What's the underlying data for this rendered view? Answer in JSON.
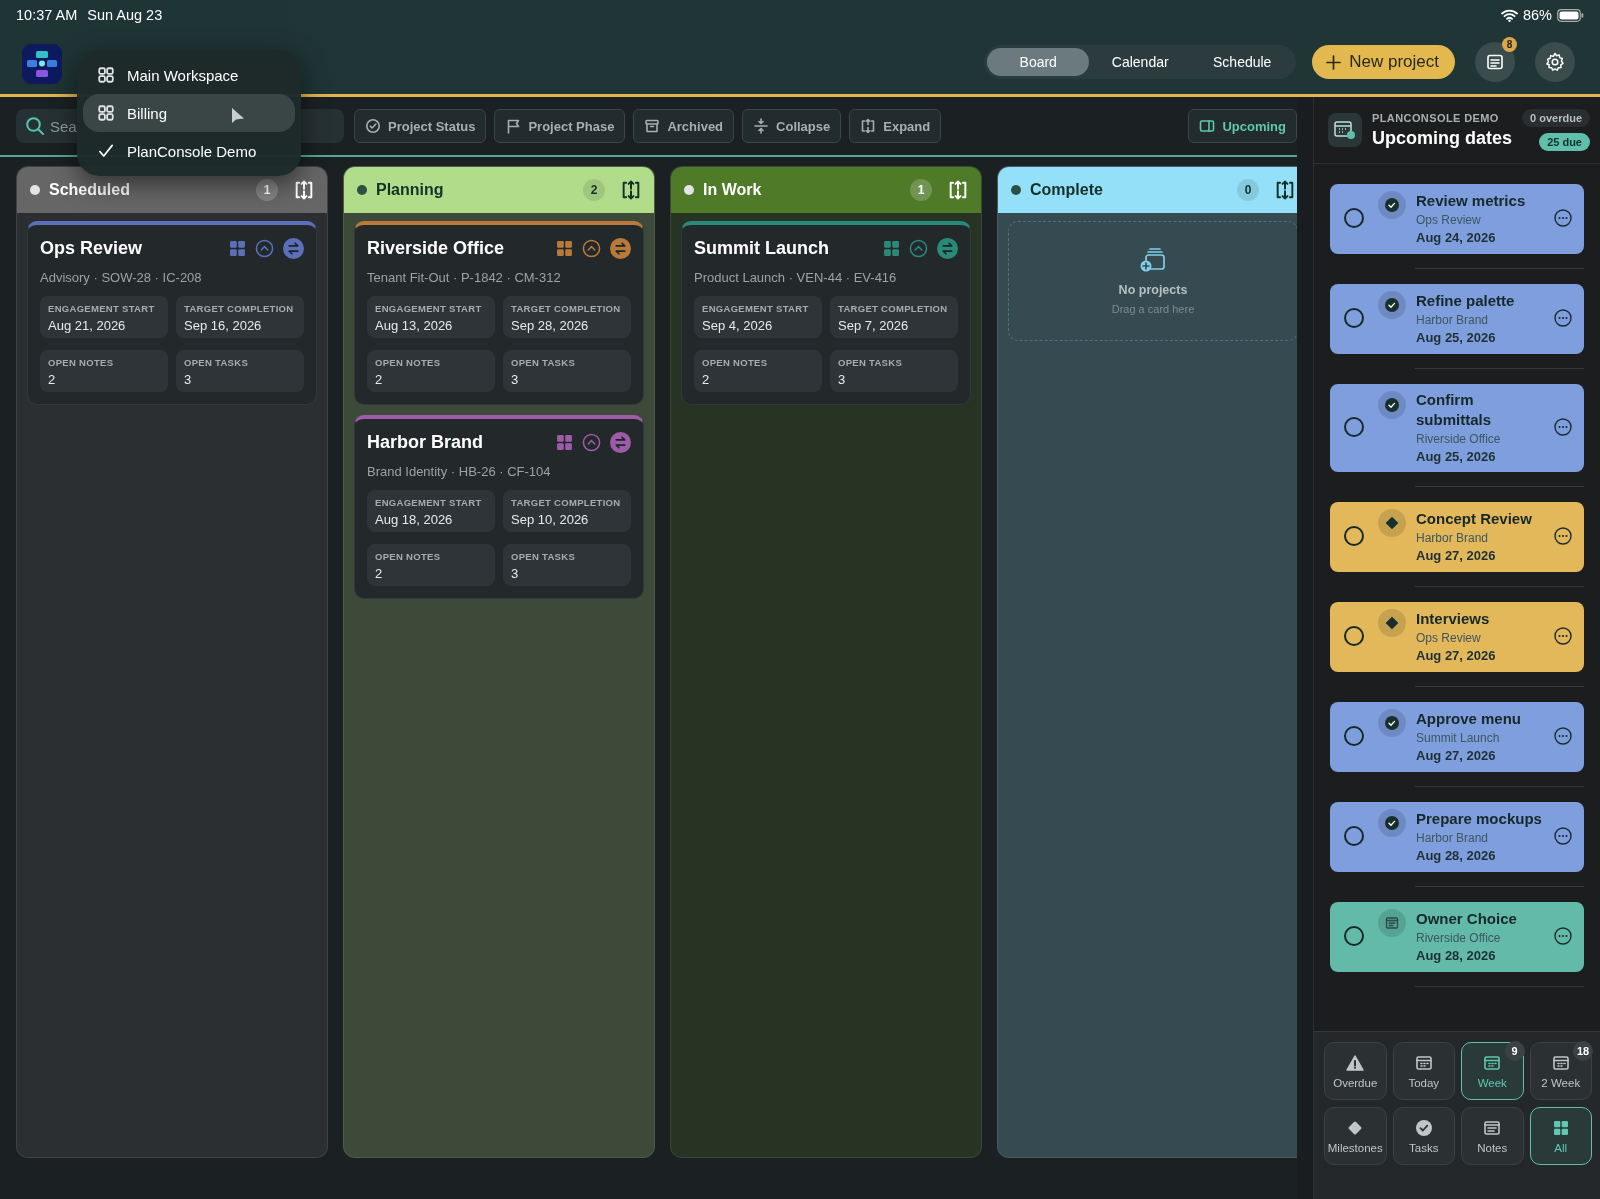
{
  "status_bar": {
    "time": "10:37 AM",
    "date": "Sun Aug 23",
    "battery": "86%"
  },
  "header": {
    "views": [
      {
        "label": "Board",
        "selected": true
      },
      {
        "label": "Calendar",
        "selected": false
      },
      {
        "label": "Schedule",
        "selected": false
      }
    ],
    "new_button": "New project",
    "notifications_badge": "8"
  },
  "workspace_menu": {
    "items": [
      {
        "label": "Main Workspace",
        "checked": false,
        "hovered": false
      },
      {
        "label": "Billing",
        "checked": false,
        "hovered": true
      },
      {
        "label": "PlanConsole Demo",
        "checked": true,
        "hovered": false
      }
    ]
  },
  "toolbar": {
    "search": {
      "placeholder": "Sea"
    },
    "filters": [
      {
        "label": "Project Status",
        "kind": "status"
      },
      {
        "label": "Project Phase",
        "kind": "phase"
      },
      {
        "label": "Archived",
        "kind": "archived"
      },
      {
        "label": "Collapse",
        "kind": "collapse"
      },
      {
        "label": "Expand",
        "kind": "expand"
      }
    ],
    "upcoming": {
      "label": "Upcoming",
      "selected": true
    }
  },
  "columns": [
    {
      "title": "Scheduled",
      "count": "1",
      "color": "#666666",
      "cards": [
        {
          "title": "Ops Review",
          "subtitle": "Advisory · SOW-28 · IC-208",
          "color": "#5b70b8",
          "stats": [
            {
              "label": "ENGAGEMENT START",
              "value": "Aug 21, 2026"
            },
            {
              "label": "TARGET COMPLETION",
              "value": "Sep 16, 2026"
            },
            {
              "label": "OPEN NOTES",
              "value": "2"
            },
            {
              "label": "OPEN TASKS",
              "value": "3"
            }
          ]
        }
      ]
    },
    {
      "title": "Planning",
      "count": "2",
      "color": "#b1dd8b",
      "cards": [
        {
          "title": "Riverside Office",
          "subtitle": "Tenant Fit-Out · P-1842 · CM-312",
          "color": "#b8793a",
          "stats": [
            {
              "label": "ENGAGEMENT START",
              "value": "Aug 13, 2026"
            },
            {
              "label": "TARGET COMPLETION",
              "value": "Sep 28, 2026"
            },
            {
              "label": "OPEN NOTES",
              "value": "2"
            },
            {
              "label": "OPEN TASKS",
              "value": "3"
            }
          ]
        },
        {
          "title": "Harbor Brand",
          "subtitle": "Brand Identity · HB-26 · CF-104",
          "color": "#9c5ca8",
          "stats": [
            {
              "label": "ENGAGEMENT START",
              "value": "Aug 18, 2026"
            },
            {
              "label": "TARGET COMPLETION",
              "value": "Sep 10, 2026"
            },
            {
              "label": "OPEN NOTES",
              "value": "2"
            },
            {
              "label": "OPEN TASKS",
              "value": "3"
            }
          ]
        }
      ]
    },
    {
      "title": "In Work",
      "count": "1",
      "color": "#4f7a28",
      "cards": [
        {
          "title": "Summit Launch",
          "subtitle": "Product Launch · VEN-44 · EV-416",
          "color": "#2a8a78",
          "stats": [
            {
              "label": "ENGAGEMENT START",
              "value": "Sep 4, 2026"
            },
            {
              "label": "TARGET COMPLETION",
              "value": "Sep 7, 2026"
            },
            {
              "label": "OPEN NOTES",
              "value": "2"
            },
            {
              "label": "OPEN TASKS",
              "value": "3"
            }
          ]
        }
      ]
    },
    {
      "title": "Complete",
      "count": "0",
      "color": "#93e0f8",
      "empty": {
        "title": "No projects",
        "hint": "Drag a card here"
      }
    }
  ],
  "sidebar": {
    "workspace": "PLANCONSOLE DEMO",
    "title": "Upcoming dates",
    "overdue": "0 overdue",
    "due": "25 due",
    "items": [
      {
        "kind": "task",
        "title": "Review metrics",
        "project": "Ops Review",
        "date": "Aug 24, 2026",
        "color": "#7f9edd",
        "done": false
      },
      {
        "kind": "task",
        "title": "Refine palette",
        "project": "Harbor Brand",
        "date": "Aug 25, 2026",
        "color": "#7f9edd",
        "done": false
      },
      {
        "kind": "task",
        "title": "Confirm submittals",
        "project": "Riverside Office",
        "date": "Aug 25, 2026",
        "color": "#7f9edd",
        "done": false
      },
      {
        "kind": "milestone",
        "title": "Concept Review",
        "project": "Harbor Brand",
        "date": "Aug 27, 2026",
        "color": "#e2b85a",
        "done": false
      },
      {
        "kind": "milestone",
        "title": "Interviews",
        "project": "Ops Review",
        "date": "Aug 27, 2026",
        "color": "#e2b85a",
        "done": false
      },
      {
        "kind": "task",
        "title": "Approve menu",
        "project": "Summit Launch",
        "date": "Aug 27, 2026",
        "color": "#7f9edd",
        "done": false
      },
      {
        "kind": "task",
        "title": "Prepare mockups",
        "project": "Harbor Brand",
        "date": "Aug 28, 2026",
        "color": "#7f9edd",
        "done": false
      },
      {
        "kind": "note",
        "title": "Owner Choice",
        "project": "Riverside Office",
        "date": "Aug 28, 2026",
        "color": "#63baa8",
        "done": false
      }
    ],
    "filters": [
      {
        "label": "Overdue",
        "kind": "overdue",
        "selected": false
      },
      {
        "label": "Today",
        "kind": "calendar",
        "selected": false
      },
      {
        "label": "Week",
        "kind": "calendar",
        "badge": "9",
        "selected": true
      },
      {
        "label": "2 Week",
        "kind": "calendar",
        "badge": "18",
        "selected": false
      },
      {
        "label": "Milestones",
        "kind": "milestone",
        "selected": false
      },
      {
        "label": "Tasks",
        "kind": "task",
        "selected": false
      },
      {
        "label": "Notes",
        "kind": "note",
        "selected": false
      },
      {
        "label": "All",
        "kind": "all",
        "selected": true
      }
    ]
  }
}
